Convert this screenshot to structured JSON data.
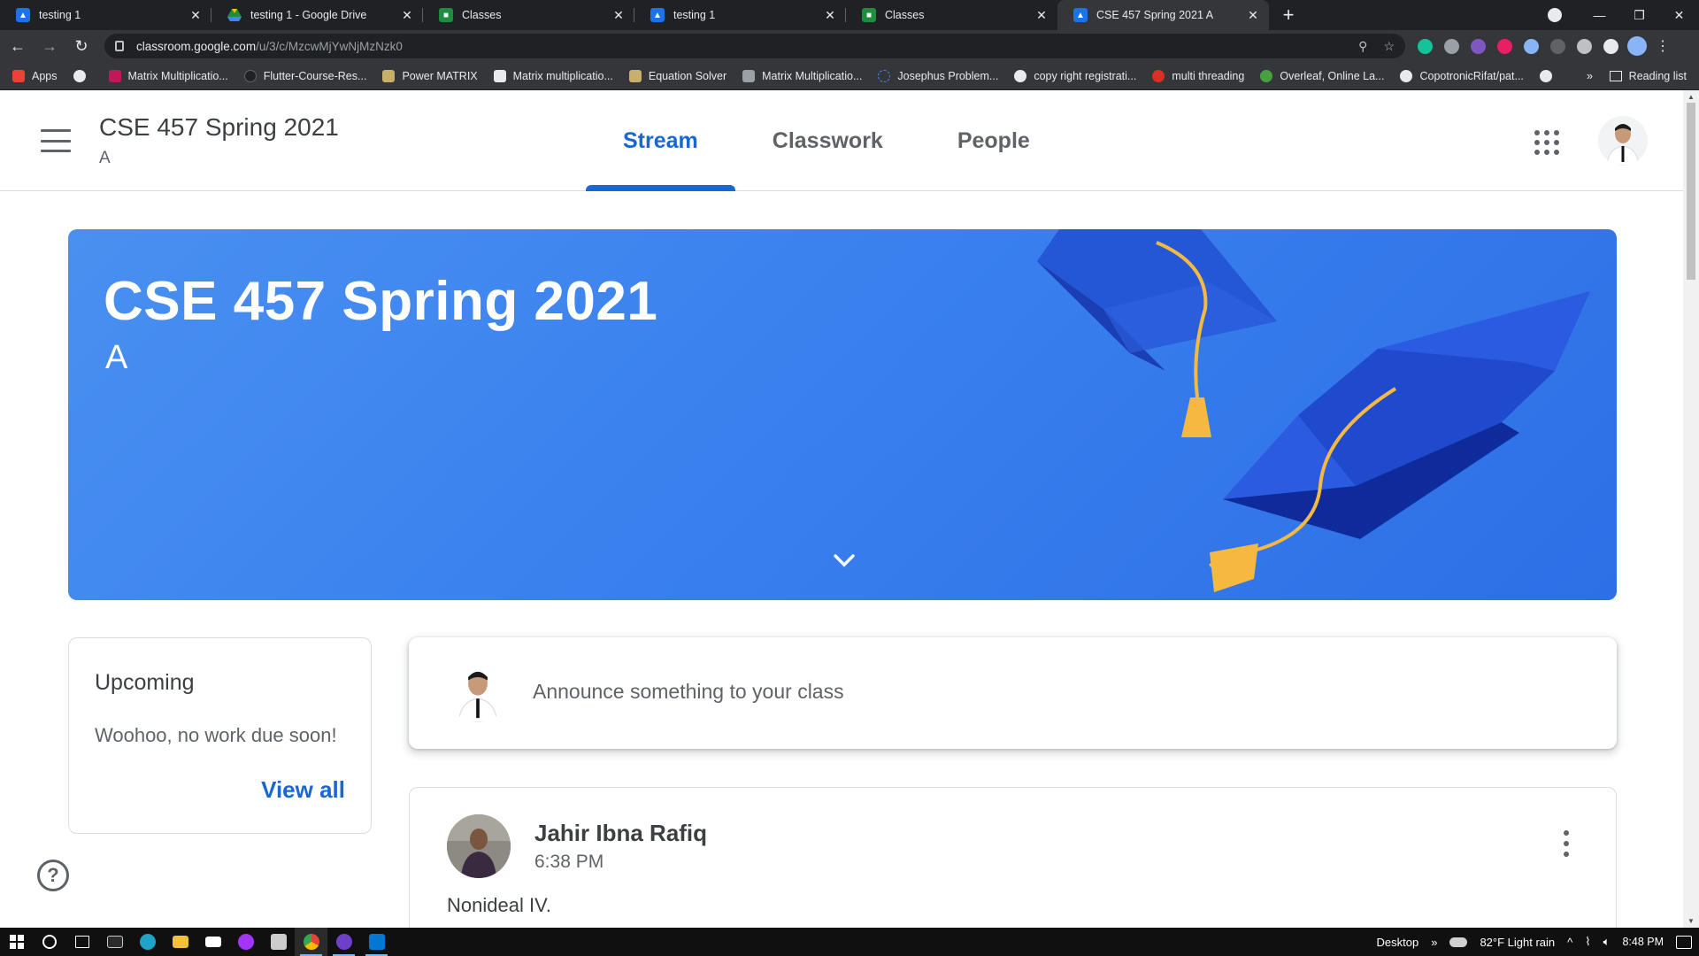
{
  "browser": {
    "tabs": [
      {
        "title": "testing 1",
        "favicon": "profile",
        "active": false
      },
      {
        "title": "testing 1 - Google Drive",
        "favicon": "drive",
        "active": false
      },
      {
        "title": "Classes",
        "favicon": "classroom",
        "active": false
      },
      {
        "title": "testing 1",
        "favicon": "profile",
        "active": false
      },
      {
        "title": "Classes",
        "favicon": "classroom",
        "active": false
      },
      {
        "title": "CSE 457 Spring 2021 A",
        "favicon": "profile",
        "active": true
      }
    ],
    "url_host": "classroom.google.com",
    "url_path": "/u/3/c/MzcwMjYwNjMzNzk0",
    "bookmarks": [
      {
        "label": "Apps",
        "color": "#ea4335"
      },
      {
        "label": "",
        "color": "#e8eaed"
      },
      {
        "label": "Matrix Multiplicatio...",
        "color": "#c2185b"
      },
      {
        "label": "Flutter-Course-Res...",
        "color": "#202124"
      },
      {
        "label": "Power MATRIX",
        "color": "#c8b06a"
      },
      {
        "label": "Matrix multiplicatio...",
        "color": "#e8eaed"
      },
      {
        "label": "Equation Solver",
        "color": "#c8b06a"
      },
      {
        "label": "Matrix Multiplicatio...",
        "color": "#9aa0a6"
      },
      {
        "label": "Josephus Problem...",
        "color": "#4285f4"
      },
      {
        "label": "copy right registrati...",
        "color": "#e8eaed"
      },
      {
        "label": "multi threading",
        "color": "#d93025"
      },
      {
        "label": "Overleaf, Online La...",
        "color": "#47a141"
      },
      {
        "label": "CopotronicRifat/pat...",
        "color": "#e8eaed"
      }
    ],
    "bookmarks_more": "»",
    "reading_list": "Reading list"
  },
  "classroom": {
    "class_name": "CSE 457 Spring 2021",
    "section": "A",
    "nav_tabs": [
      "Stream",
      "Classwork",
      "People"
    ],
    "active_tab": "Stream",
    "banner_color": "#3b82ef",
    "upcoming": {
      "title": "Upcoming",
      "message": "Woohoo, no work due soon!",
      "link": "View all"
    },
    "announce_placeholder": "Announce something to your class",
    "post": {
      "author": "Jahir Ibna Rafiq",
      "time": "6:38 PM",
      "body": "Nonideal IV."
    },
    "help_icon": "?"
  },
  "taskbar": {
    "desktop_label": "Desktop",
    "weather": "82°F  Light rain",
    "clock": "8:48 PM"
  }
}
